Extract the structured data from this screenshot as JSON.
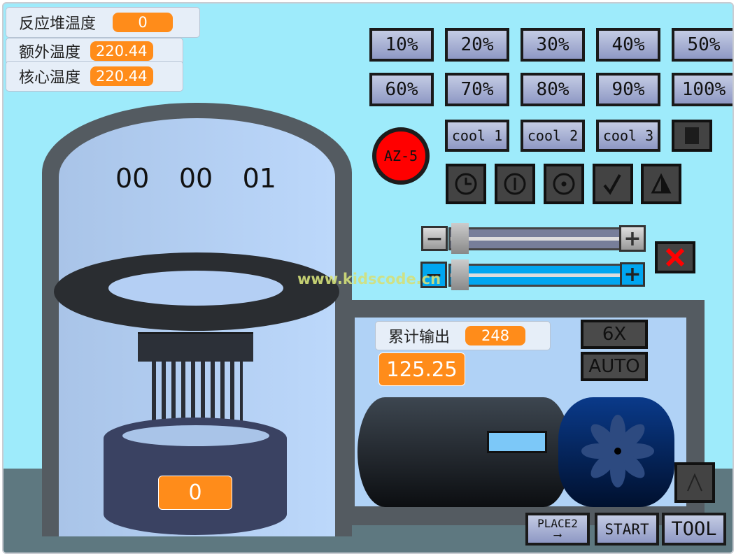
{
  "monitors": [
    {
      "label": "反应堆温度",
      "value": "0"
    },
    {
      "label": "额外温度",
      "value": "220.44"
    },
    {
      "label": "核心温度",
      "value": "220.44"
    }
  ],
  "timer": {
    "hours": "00",
    "minutes": "00",
    "seconds": "01"
  },
  "power_buttons": [
    "10%",
    "20%",
    "30%",
    "40%",
    "50%",
    "60%",
    "70%",
    "80%",
    "90%",
    "100%"
  ],
  "cool_buttons": [
    "cool 1",
    "cool 2",
    "cool 3"
  ],
  "az5_label": "AZ-5",
  "icon_buttons": [
    "clock-icon",
    "power-icon",
    "target-icon",
    "check-icon",
    "warning-triangle-icon"
  ],
  "sliders": {
    "minus": "−",
    "plus": "+",
    "top_level": 0,
    "bottom_level": 0
  },
  "watermark": "www.kidscode.cn",
  "output": {
    "label": "累计输出",
    "value": "248",
    "power": "125.25"
  },
  "speed_button": "6X",
  "auto_button": "AUTO",
  "drum_value": "0",
  "nav_buttons": {
    "place2": "PLACE2",
    "start": "START",
    "tool": "TOOL"
  },
  "colors": {
    "accent": "#ff8c1a",
    "background": "#9eebfb",
    "danger": "#ff0000",
    "slider_blue": "#00a6f0"
  }
}
